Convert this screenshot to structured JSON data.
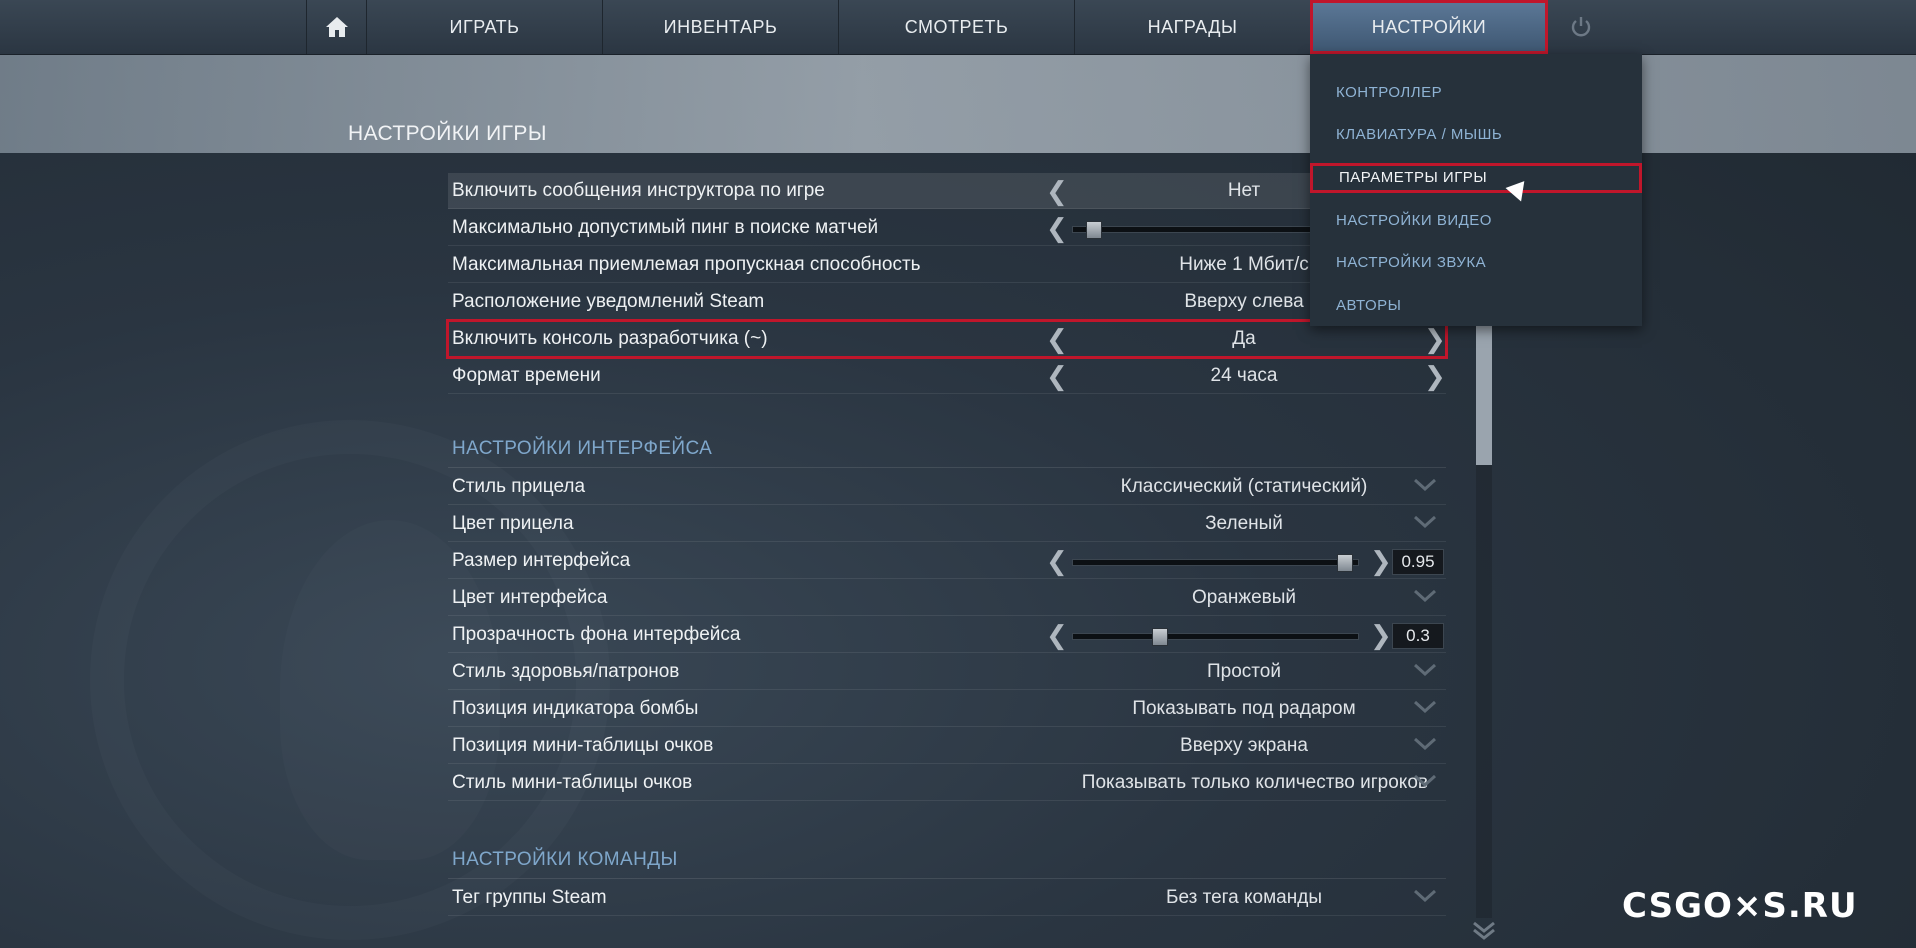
{
  "nav": {
    "home_icon": "home-icon",
    "play": "ИГРАТЬ",
    "inventory": "ИНВЕНТАРЬ",
    "watch": "СМОТРЕТЬ",
    "awards": "НАГРАДЫ",
    "settings": "НАСТРОЙКИ",
    "power_icon": "power-icon"
  },
  "page_title": "НАСТРОЙКИ ИГРЫ",
  "dropdown": [
    {
      "label": "КОНТРОЛЛЕР"
    },
    {
      "label": "КЛАВИАТУРА / МЫШЬ"
    },
    {
      "label": "ПАРАМЕТРЫ ИГРЫ"
    },
    {
      "label": "НАСТРОЙКИ ВИДЕО"
    },
    {
      "label": "НАСТРОЙКИ ЗВУКА"
    },
    {
      "label": "АВТОРЫ"
    }
  ],
  "game_rows": [
    {
      "label": "Включить сообщения инструктора по игре",
      "value": "Нет"
    },
    {
      "label": "Максимально допустимый пинг в поиске матчей",
      "slider": 0.07
    },
    {
      "label": "Максимальная приемлемая пропускная способность",
      "value": "Ниже 1 Мбит/с"
    },
    {
      "label": "Расположение уведомлений Steam",
      "value": "Вверху слева"
    },
    {
      "label": "Включить консоль разработчика (~)",
      "value": "Да"
    },
    {
      "label": "Формат времени",
      "value": "24 часа"
    }
  ],
  "interface_section": "НАСТРОЙКИ ИНТЕРФЕЙСА",
  "interface_rows": [
    {
      "label": "Стиль прицела",
      "value": "Классический (статический)"
    },
    {
      "label": "Цвет прицела",
      "value": "Зеленый"
    },
    {
      "label": "Размер интерфейса",
      "slider": 0.95,
      "number": "0.95"
    },
    {
      "label": "Цвет интерфейса",
      "value": "Оранжевый"
    },
    {
      "label": "Прозрачность фона интерфейса",
      "slider": 0.3,
      "number": "0.3"
    },
    {
      "label": "Стиль здоровья/патронов",
      "value": "Простой"
    },
    {
      "label": "Позиция индикатора бомбы",
      "value": "Показывать под радаром"
    },
    {
      "label": "Позиция мини-таблицы очков",
      "value": "Вверху экрана"
    },
    {
      "label": "Стиль мини-таблицы очков",
      "value": "Показывать только количество игроков"
    }
  ],
  "team_section": "НАСТРОЙКИ КОМАНДЫ",
  "team_rows": [
    {
      "label": "Тег группы Steam",
      "value": "Без тега команды"
    }
  ],
  "watermark": "CSGO×S.RU",
  "colors": {
    "accent_red": "#c0162b",
    "section_blue": "#7fa7cb"
  }
}
